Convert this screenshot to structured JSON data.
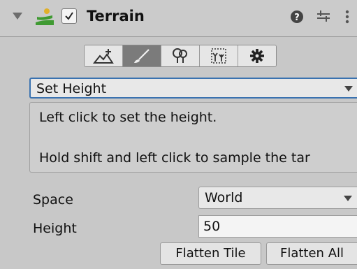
{
  "header": {
    "title": "Terrain",
    "enabled": true,
    "icons": [
      "foldout-arrow-icon",
      "terrain-icon",
      "help-icon",
      "presets-icon",
      "menu-icon"
    ]
  },
  "toolbar": {
    "tools": [
      {
        "name": "create-neighbor-terrains",
        "icon": "terrain-add-icon"
      },
      {
        "name": "paint-terrain",
        "icon": "brush-icon",
        "active": true
      },
      {
        "name": "paint-trees",
        "icon": "trees-icon"
      },
      {
        "name": "paint-details",
        "icon": "details-icon"
      },
      {
        "name": "terrain-settings",
        "icon": "gear-icon"
      }
    ]
  },
  "mode": {
    "selected": "Set Height"
  },
  "help": {
    "line1": "Left click to set the height.",
    "line2": "Hold shift and left click to sample the tar"
  },
  "properties": {
    "space": {
      "label": "Space",
      "value": "World"
    },
    "height": {
      "label": "Height",
      "value": "50"
    }
  },
  "buttons": {
    "flatten_tile": "Flatten Tile",
    "flatten_all": "Flatten All"
  },
  "colors": {
    "background": "#c8c8c8",
    "focus_border": "#3a72b0",
    "active_tool": "#7b7b7b",
    "terrain_green": "#3f9a32",
    "terrain_yellow": "#e0b02a"
  }
}
